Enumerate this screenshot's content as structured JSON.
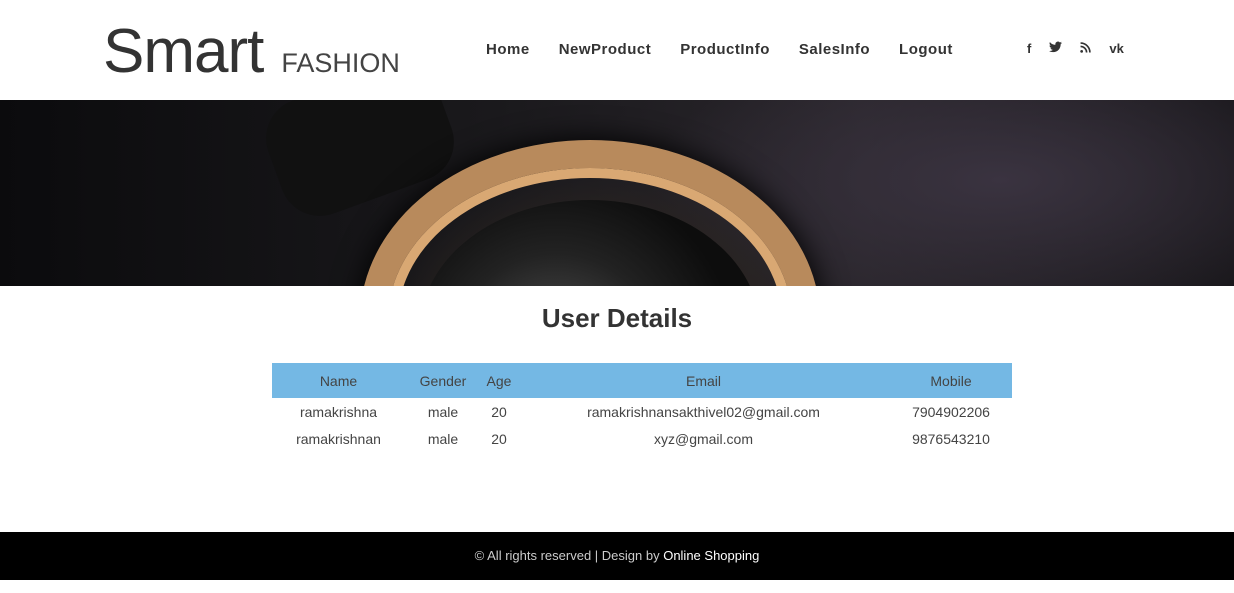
{
  "header": {
    "logo_main": "Smart",
    "logo_sub": "FASHION",
    "nav": [
      "Home",
      "NewProduct",
      "ProductInfo",
      "SalesInfo",
      "Logout"
    ],
    "social": [
      {
        "icon": "facebook-icon",
        "glyph": "f"
      },
      {
        "icon": "twitter-icon",
        "glyph": "🐦"
      },
      {
        "icon": "rss-icon",
        "glyph": "≈"
      },
      {
        "icon": "vk-icon",
        "glyph": "vk"
      }
    ]
  },
  "main": {
    "title": "User Details",
    "columns": [
      "Name",
      "Gender",
      "Age",
      "Email",
      "Mobile"
    ],
    "rows": [
      [
        "ramakrishna",
        "male",
        "20",
        "ramakrishnansakthivel02@gmail.com",
        "7904902206"
      ],
      [
        "ramakrishnan",
        "male",
        "20",
        "xyz@gmail.com",
        "9876543210"
      ]
    ]
  },
  "footer": {
    "text": "© All rights reserved | Design by ",
    "link": "Online Shopping"
  },
  "colors": {
    "table_header": "#74b8e4",
    "footer_bg": "#000000"
  }
}
